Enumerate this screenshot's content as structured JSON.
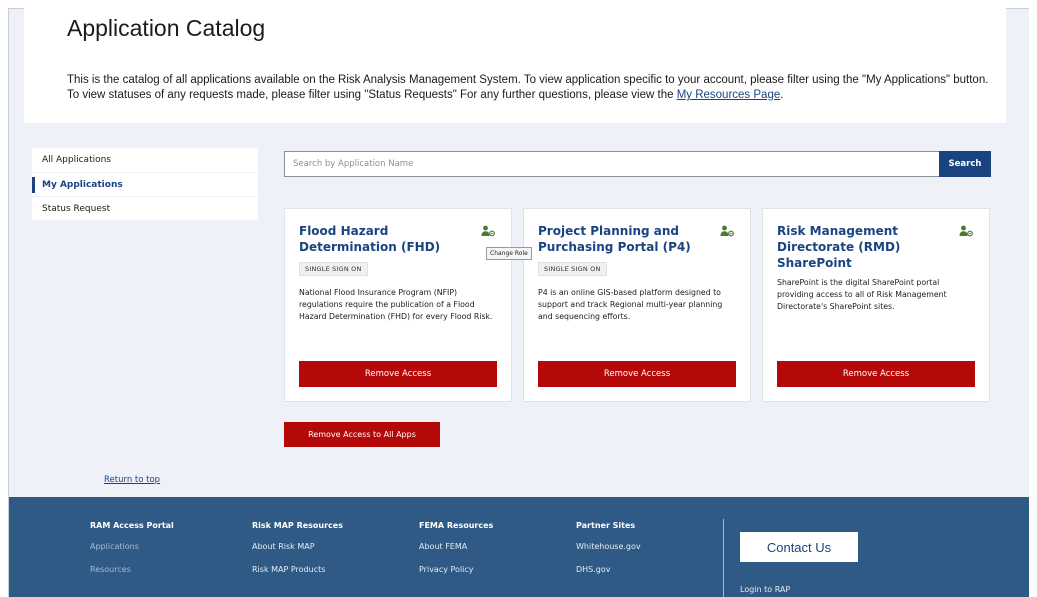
{
  "header": {
    "title": "Application Catalog",
    "intro_text": "This is the catalog of all applications available on the Risk Analysis Management System. To view application specific to your account, please filter using the \"My Applications\" button. To view statuses of any requests made, please filter using \"Status Requests\" For any further questions, please view the ",
    "intro_link": "My Resources Page",
    "intro_end": "."
  },
  "sidenav": {
    "items": [
      {
        "label": "All Applications",
        "active": false
      },
      {
        "label": "My Applications",
        "active": true
      },
      {
        "label": "Status Request",
        "active": false
      }
    ]
  },
  "search": {
    "placeholder": "Search by Application Name",
    "value": "",
    "button_label": "Search"
  },
  "cards": [
    {
      "title": "Flood Hazard Determination (FHD)",
      "badge": "SINGLE SIGN ON",
      "description": "National Flood Insurance Program (NFIP) regulations require the publication of a Flood Hazard Determination (FHD) for every Flood Risk.",
      "button_label": "Remove Access",
      "icon": "change-role-icon"
    },
    {
      "title": "Project Planning and Purchasing Portal (P4)",
      "badge": "SINGLE SIGN ON",
      "description": "P4 is an online GIS-based platform designed to support and track Regional multi-year planning and sequencing efforts.",
      "button_label": "Remove Access",
      "icon": "change-role-icon"
    },
    {
      "title": "Risk Management Directorate (RMD) SharePoint",
      "badge": "",
      "description": "SharePoint is the digital SharePoint portal providing access to all of Risk Management Directorate's SharePoint sites.",
      "button_label": "Remove Access",
      "icon": "change-role-icon"
    }
  ],
  "tooltip": "Change Role",
  "remove_all_label": "Remove Access to All Apps",
  "return_to_top": "Return to top",
  "footer": {
    "columns": [
      {
        "heading": "RAM Access Portal",
        "links": [
          "Applications",
          "Resources"
        ]
      },
      {
        "heading": "Risk MAP Resources",
        "links": [
          "About Risk MAP",
          "Risk MAP Products"
        ]
      },
      {
        "heading": "FEMA Resources",
        "links": [
          "About FEMA",
          "Privacy Policy"
        ]
      },
      {
        "heading": "Partner Sites",
        "links": [
          "Whitehouse.gov",
          "DHS.gov"
        ]
      }
    ],
    "contact_label": "Contact Us",
    "login_label": "Login to RAP"
  },
  "colors": {
    "primary": "#1a4480",
    "danger": "#b50909",
    "footer_bg": "#2e5a85",
    "page_bg": "#eef2f8",
    "icon_green": "#4d7a2a"
  }
}
